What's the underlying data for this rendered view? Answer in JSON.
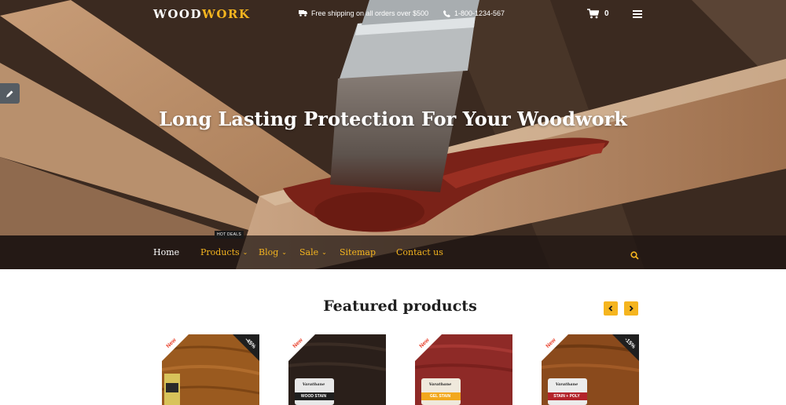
{
  "brand": {
    "logo_part1": "WOOD",
    "logo_part2": "WORK",
    "accent_color": "#f5b51f"
  },
  "topbar": {
    "shipping_text": "Free shipping on all orders over $500",
    "phone": "1-800-1234-567",
    "cart_count": "0"
  },
  "hero": {
    "headline": "Long Lasting Protection For Your Woodwork"
  },
  "nav": {
    "items": [
      {
        "label": "Home",
        "active": true,
        "has_dropdown": false
      },
      {
        "label": "Products",
        "active": false,
        "has_dropdown": true
      },
      {
        "label": "Blog",
        "active": false,
        "has_dropdown": true
      },
      {
        "label": "Sale",
        "active": false,
        "has_dropdown": true
      },
      {
        "label": "Sitemap",
        "active": false,
        "has_dropdown": false
      },
      {
        "label": "Contact us",
        "active": false,
        "has_dropdown": false
      }
    ],
    "hot_badge": "HOT DEALS"
  },
  "featured": {
    "title": "Featured products",
    "products": [
      {
        "badge_new": "New",
        "badge_sale": "-45%",
        "image": "oak-stain-swatch"
      },
      {
        "badge_new": "New",
        "badge_sale": "",
        "image": "dark-wood-stain-can",
        "can_label": "WOOD STAIN",
        "can_brand": "Varathane"
      },
      {
        "badge_new": "New",
        "badge_sale": "",
        "image": "red-gel-stain-can",
        "can_label": "GEL STAIN",
        "can_brand": "Varathane"
      },
      {
        "badge_new": "New",
        "badge_sale": "-15%",
        "image": "stain-poly-can",
        "can_label": "STAIN + POLY",
        "can_brand": "Varathane"
      }
    ]
  }
}
